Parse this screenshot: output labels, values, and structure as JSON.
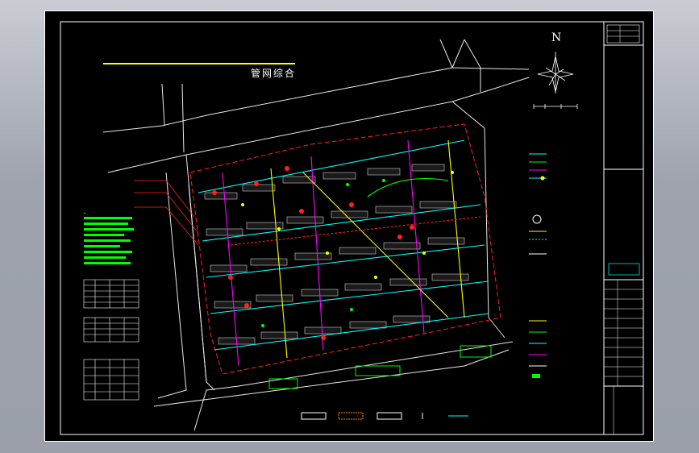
{
  "drawing": {
    "title": "管网综合",
    "north_label": "N"
  },
  "colors": {
    "background": "#000000",
    "frame": "#ffffff",
    "road": "#e8e8e8",
    "title_underline": "#ffff00",
    "site_boundary": "#ff2020",
    "water_pipe": "#00ffff",
    "storm_pipe": "#ffff00",
    "sewer_pipe": "#ff00ff",
    "gas_pipe": "#00ff00",
    "building": "#d0d0d0",
    "legend_text": "#00ff00",
    "title_block_accent": "#00ffff"
  },
  "icons": [
    "north-arrow-icon",
    "compass-rose-icon"
  ]
}
